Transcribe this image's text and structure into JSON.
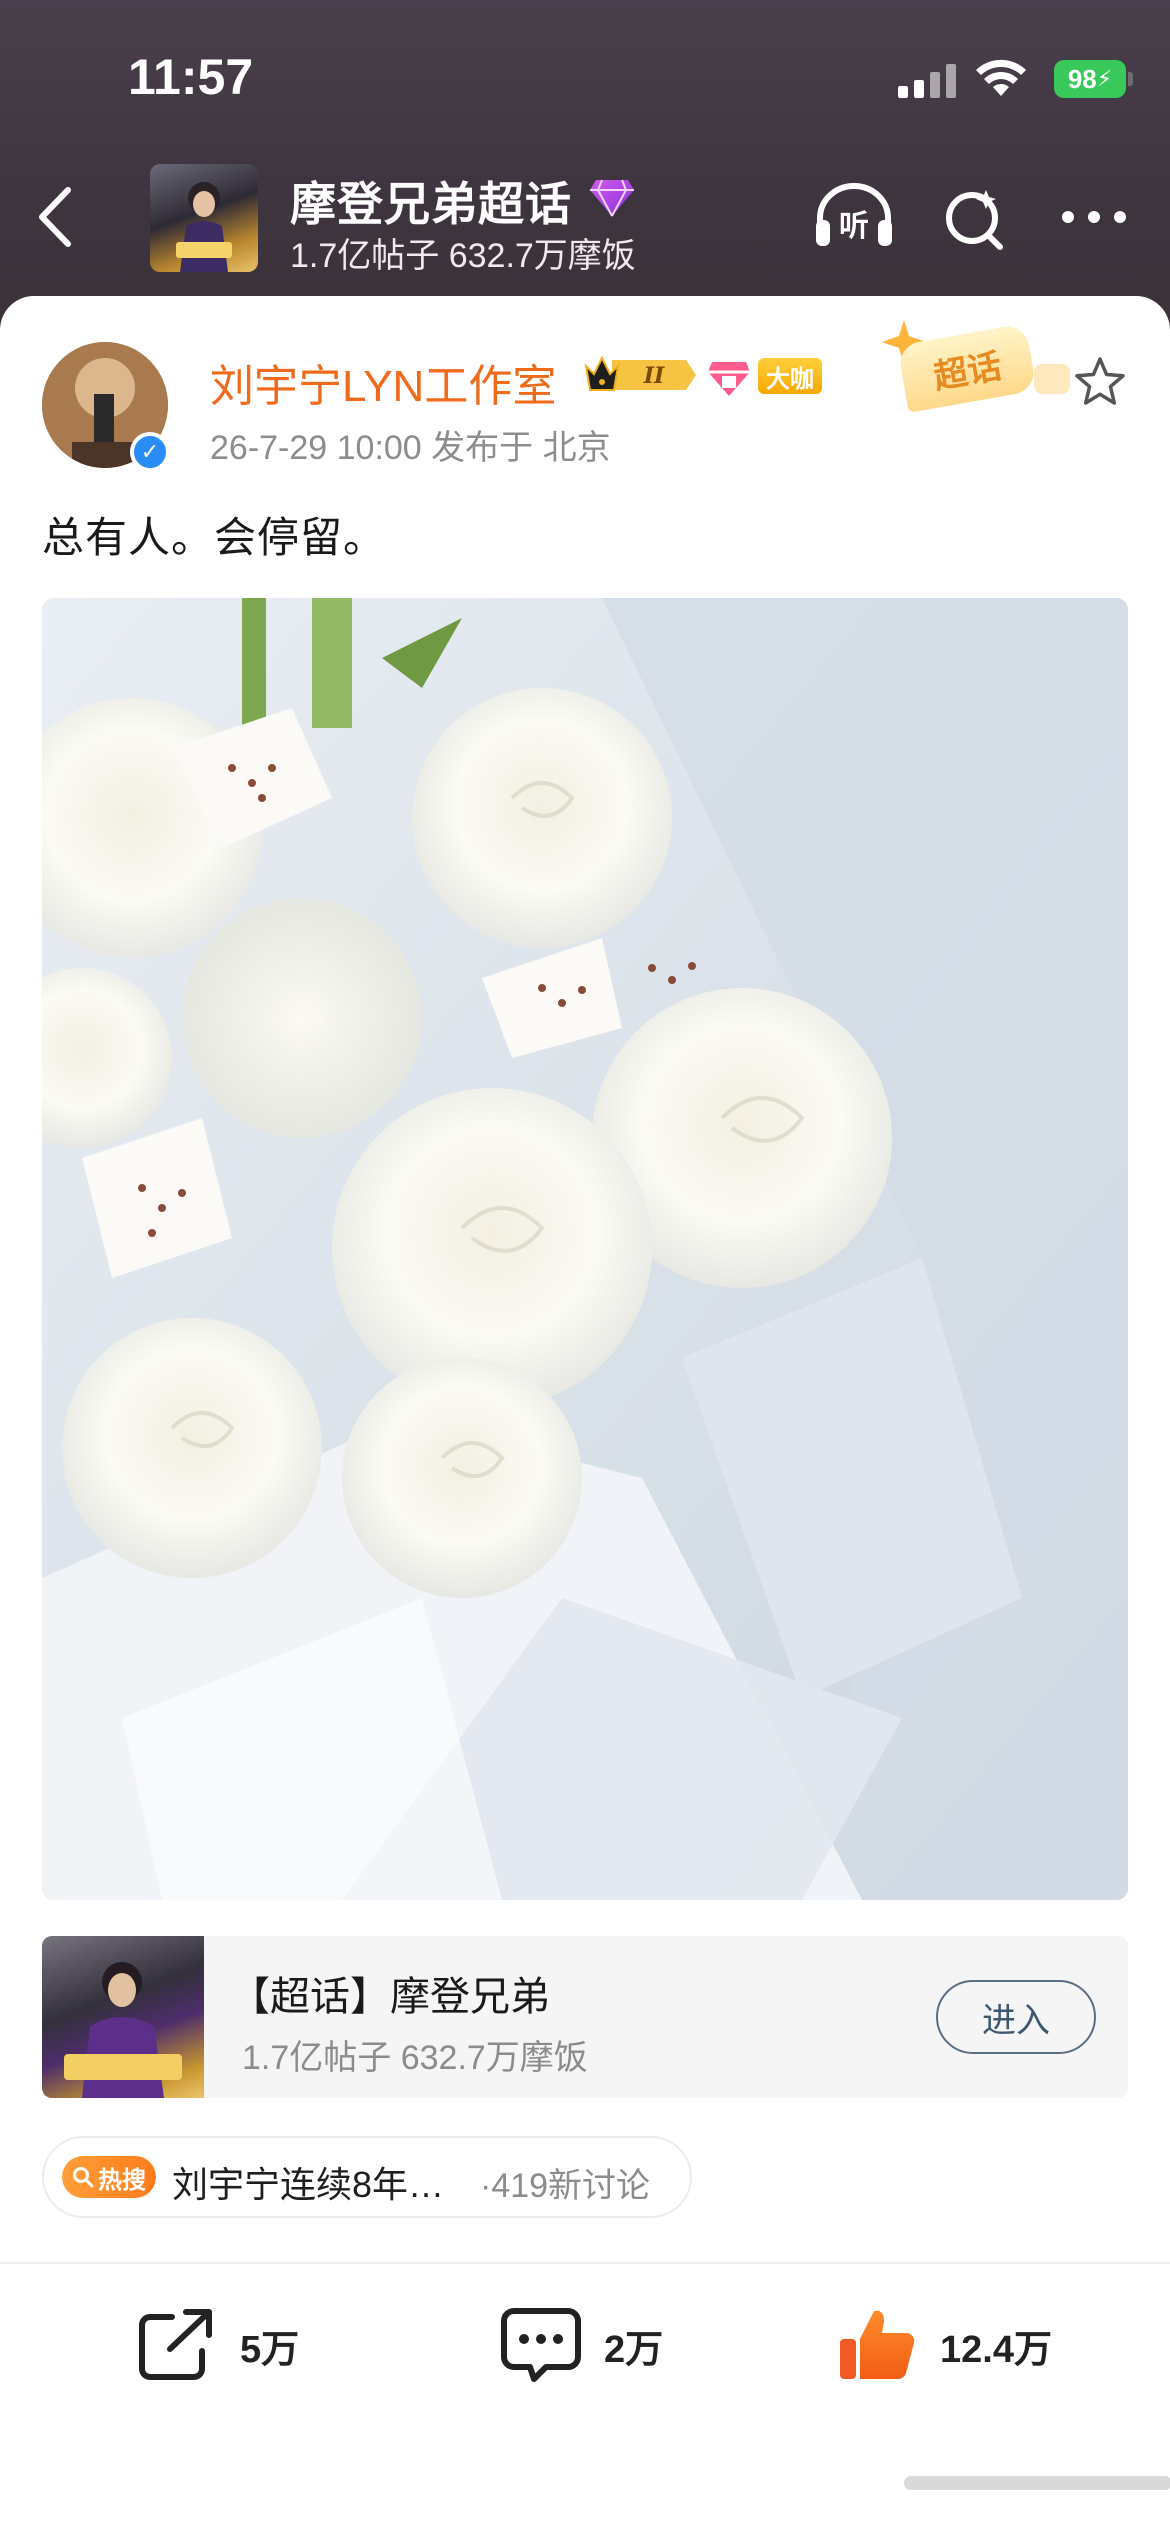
{
  "status_bar": {
    "time": "11:57",
    "battery": "98"
  },
  "header": {
    "topic_title": "摩登兄弟超话",
    "topic_stats": "1.7亿帖子 632.7万摩饭",
    "listen_label": "听"
  },
  "post": {
    "author": "刘宇宁LYN工作室",
    "level_badge": "II",
    "rank_badge": "大咖",
    "meta": "26-7-29 10:00   发布于 北京",
    "chaohua_tag": "超话",
    "text": "总有人。会停留。"
  },
  "topic_card": {
    "title": "【超话】摩登兄弟",
    "stats": "1.7亿帖子 632.7万摩饭",
    "enter_label": "进入"
  },
  "hot_search": {
    "tag": "热搜",
    "text": "刘宇宁连续8年…",
    "count": "·419新讨论"
  },
  "actions": {
    "share": "5万",
    "comment": "2万",
    "like": "12.4万"
  },
  "colors": {
    "header_bg": "#3f3540",
    "author_orange": "#f06a1b",
    "hot_orange": "#ff7a1a",
    "battery_green": "#39c95a"
  }
}
